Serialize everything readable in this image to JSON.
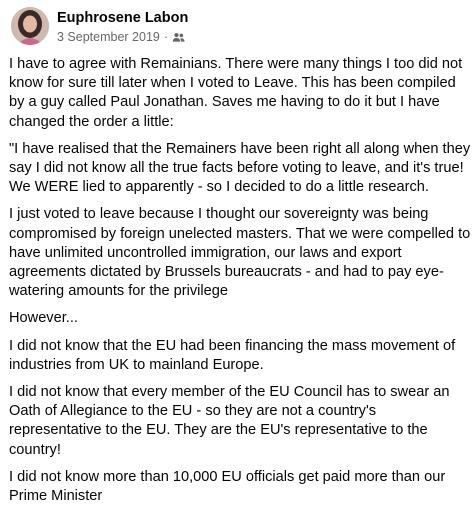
{
  "post": {
    "author": "Euphrosene Labon",
    "date": "3 September 2019",
    "separator": "·",
    "audience_icon": "friends-icon",
    "paragraphs": [
      "I have to agree with Remainians. There were many things I too did not know for sure till later when I voted to Leave. This has been compiled by a guy called Paul Jonathan. Saves me having to do it but I have changed the order a little:",
      "\"I have realised that the Remainers have been right all along when they say I did not know all the true facts before voting to leave, and it's true! We WERE lied to apparently - so I decided to do a little research.",
      "I just voted to leave because I thought our sovereignty was being compromised by foreign unelected masters. That we were compelled to have unlimited uncontrolled immigration, our laws and export agreements dictated by Brussels bureaucrats - and had to pay eye-watering amounts for the privilege",
      "However...",
      "I did not know that the EU had been financing the mass movement of industries from UK to mainland Europe.",
      "I did not know that every member of the EU Council has to swear an Oath of Allegiance to the EU - so they are not a country's representative to the EU. They are the EU's representative to the country!",
      "I did not know more than 10,000 EU officials get paid more than our Prime Minister"
    ]
  }
}
